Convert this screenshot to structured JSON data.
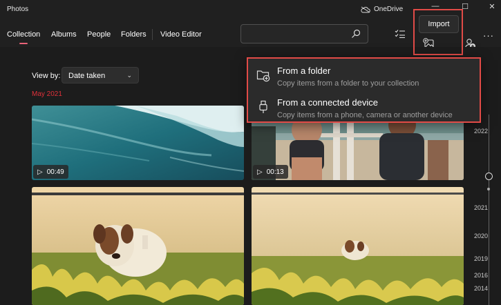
{
  "window": {
    "title": "Photos",
    "onedrive_label": "OneDrive",
    "minimize": "—",
    "maximize": "☐",
    "close": "✕"
  },
  "nav": {
    "tabs": [
      {
        "label": "Collection",
        "active": true
      },
      {
        "label": "Albums"
      },
      {
        "label": "People"
      },
      {
        "label": "Folders"
      },
      {
        "label": "Video Editor"
      }
    ],
    "search": {
      "value": "",
      "placeholder": ""
    },
    "more_label": "···"
  },
  "toolbar": {
    "import_tooltip": "Import"
  },
  "import_menu": {
    "items": [
      {
        "title": "From a folder",
        "subtitle": "Copy items from a folder to your collection",
        "icon": "folder-add-icon"
      },
      {
        "title": "From a connected device",
        "subtitle": "Copy items from a phone, camera or another device",
        "icon": "usb-icon"
      }
    ]
  },
  "content": {
    "view_by_label": "View by:",
    "view_by_value": "Date taken",
    "month_label": "May 2021",
    "tiles": [
      {
        "kind": "video",
        "duration": "00:49",
        "scene": "ocean-waves"
      },
      {
        "kind": "video",
        "duration": "00:13",
        "scene": "runners-beach"
      },
      {
        "kind": "photo",
        "scene": "dog-in-flowers"
      },
      {
        "kind": "photo",
        "scene": "dog-in-flowers-far"
      }
    ]
  },
  "timeline": {
    "years": [
      "2022",
      "2021",
      "2020",
      "2019",
      "2016",
      "2014"
    ]
  },
  "colors": {
    "accent_tab": "#e96379",
    "month_red": "#e0313a",
    "highlight": "#e24b47"
  }
}
